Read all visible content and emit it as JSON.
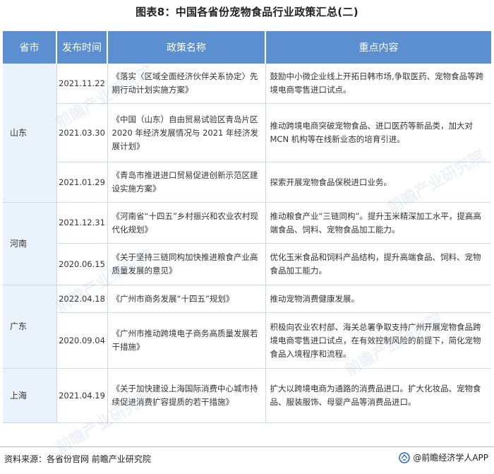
{
  "title": "图表8：中国各省份宠物食品行业政策汇总(二)",
  "columns": [
    "省市",
    "发布时间",
    "政策名称",
    "重点内容"
  ],
  "provinces": [
    "山东",
    "河南",
    "广东",
    "上海"
  ],
  "rows": [
    {
      "date": "2021.11.22",
      "name": "《落实〈区域全面经济伙伴关系协定〉先期行动计划实施方案》",
      "content": "鼓励中小微企业线上开拓日韩市场,争取医药、宠物食品等跨境电商零售进口试点。"
    },
    {
      "date": "2021.03.30",
      "name": "《中国（山东）自由贸易试验区青岛片区 2020 年经济发展情况与 2021 年经济发展计划》",
      "content": "推动跨境电商突破宠物食品、进口医药等新品类，加大对 MCN 机构等在线新业态的培育引进。"
    },
    {
      "date": "2021.01.29",
      "name": "《青岛市推进进口贸易促进创新示范区建设实施方案》",
      "content": "探索开展宠物食品保税进口业务。"
    },
    {
      "date": "2021.12.31",
      "name": "《河南省“十四五”乡村振兴和农业农村现代化规划》",
      "content": "推动粮食产业“三链同构”。提升玉米精深加工水平，提高高端食品、饲料、宠物食品加工能力。"
    },
    {
      "date": "2020.06.15",
      "name": "《关于坚持三链同构加快推进粮食产业高质量发展的意见》",
      "content": "优化玉米食品和饲料产品结构，提升高端食品、饲料、宠物食品加工能力。"
    },
    {
      "date": "2022.04.18",
      "name": "《广州市商务发展“十四五”规划》",
      "content": "推动宠物消费健康发展。"
    },
    {
      "date": "2020.09.04",
      "name": "《广州市推动跨境电子商务高质量发展若干措施》",
      "content": "积极向农业农村部、海关总署争取支持广州开展宠物食品跨境电商零售进口试点，在有效控制风险的前提下，简化宠物食品入境程序和流程。"
    },
    {
      "date": "2021.04.19",
      "name": "《关于加快建设上海国际消费中心城市持续促进消费扩容提质的若干措施》",
      "content": "扩大以跨境电商为通路的消费品进口。扩大化妆品、宠物食品、服装服饰、母婴产品等消费品进口。"
    }
  ],
  "footer": {
    "source": "资料来源：各省份官网 前瞻产业研究院",
    "brand": "@前瞻经济学人APP"
  },
  "watermark": "前瞻产业研究院",
  "colors": {
    "header_bg": "#5b8fd0",
    "province_bg": "#eaf2fb",
    "border": "#cfd8e6"
  }
}
